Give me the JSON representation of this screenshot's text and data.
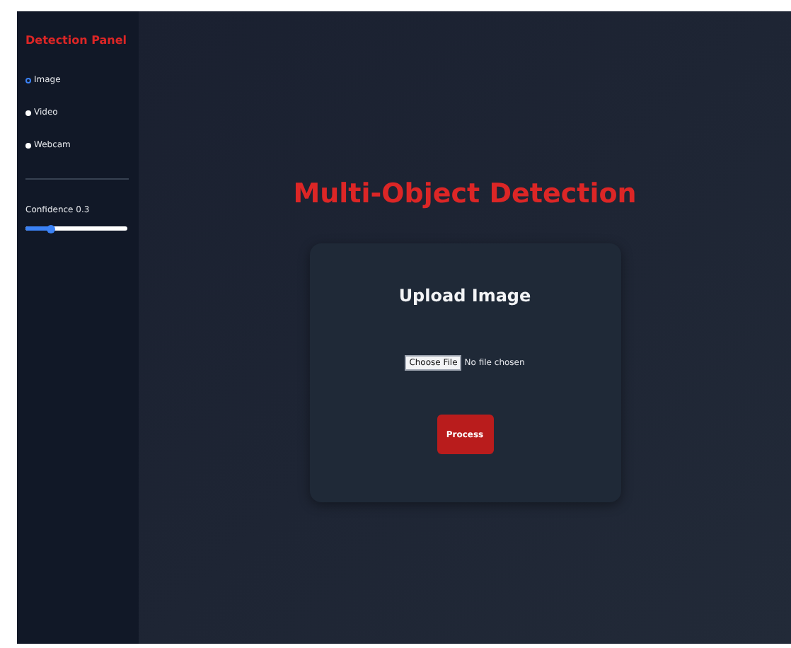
{
  "sidebar": {
    "title": "Detection Panel",
    "modes": [
      {
        "label": "Image",
        "selected": true
      },
      {
        "label": "Video",
        "selected": false
      },
      {
        "label": "Webcam",
        "selected": false
      }
    ],
    "confidence": {
      "label": "Confidence 0.3",
      "level": 0.25
    }
  },
  "main": {
    "title": "Multi-Object Detection",
    "card": {
      "title": "Upload Image",
      "file_button": "Choose File",
      "file_status": "No file chosen",
      "submit": "Process"
    }
  }
}
